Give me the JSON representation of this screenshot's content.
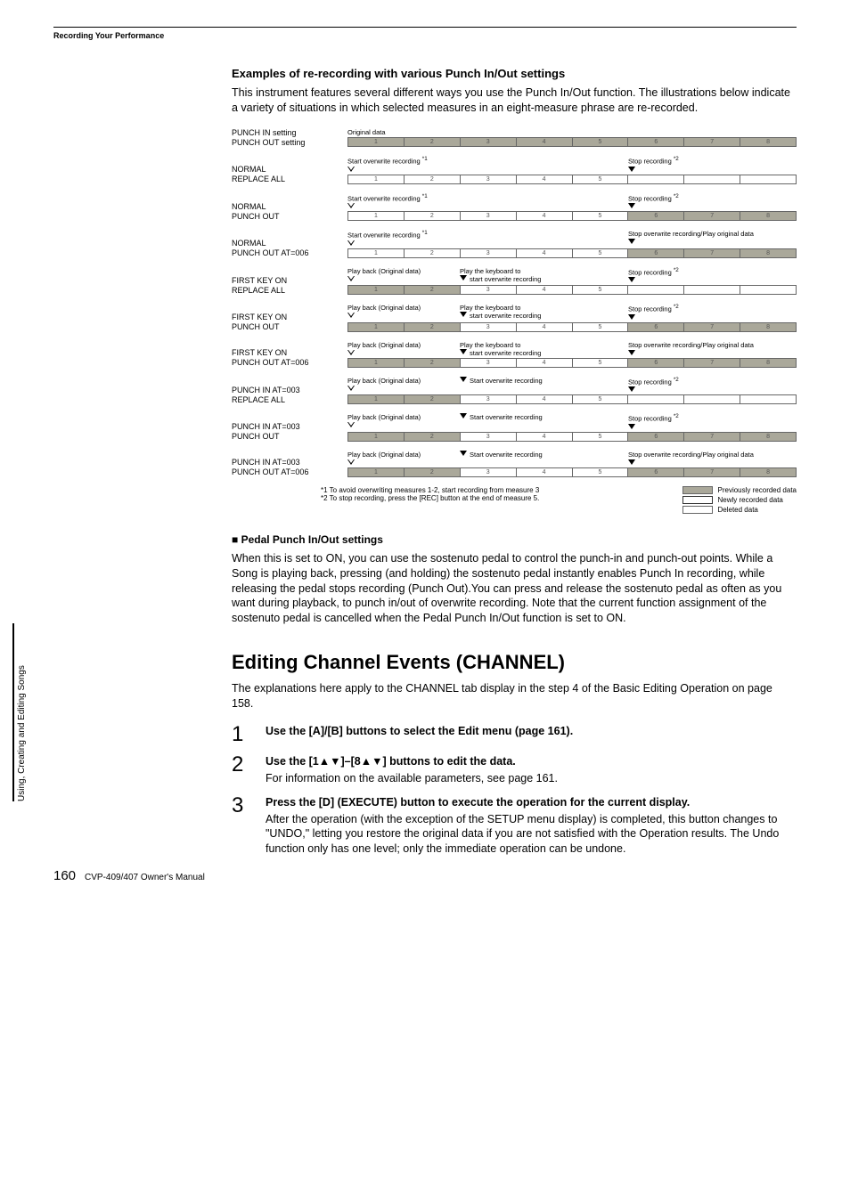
{
  "header": {
    "section": "Recording Your Performance"
  },
  "intro": {
    "title": "Examples of re-recording with various Punch In/Out settings",
    "body": "This instrument features several different ways you use the Punch In/Out function. The illustrations below indicate a variety of situations in which selected measures in an eight-measure phrase are re-recorded."
  },
  "diagram": {
    "row_label_1": "PUNCH IN setting",
    "row_label_2": "PUNCH OUT setting",
    "original": "Original data",
    "start_overwrite": "Start overwrite recording",
    "stop_rec": "Stop recording",
    "stop_over_play": "Stop overwrite recording/Play original data",
    "playback_orig": "Play back (Original data)",
    "play_kb": "Play the keyboard to",
    "start_over": "start overwrite recording",
    "start_over_line": "Start overwrite recording",
    "sup1": "*1",
    "sup2": "*2",
    "rows": [
      {
        "l1": "NORMAL",
        "l2": "REPLACE ALL"
      },
      {
        "l1": "NORMAL",
        "l2": "PUNCH OUT"
      },
      {
        "l1": "NORMAL",
        "l2": "PUNCH OUT AT=006"
      },
      {
        "l1": "FIRST KEY ON",
        "l2": "REPLACE ALL"
      },
      {
        "l1": "FIRST KEY ON",
        "l2": "PUNCH OUT"
      },
      {
        "l1": "FIRST KEY ON",
        "l2": "PUNCH OUT AT=006"
      },
      {
        "l1": "PUNCH IN AT=003",
        "l2": "REPLACE ALL"
      },
      {
        "l1": "PUNCH IN AT=003",
        "l2": "PUNCH OUT"
      },
      {
        "l1": "PUNCH IN AT=003",
        "l2": "PUNCH OUT AT=006"
      }
    ],
    "foot1": "*1 To avoid overwriting measures 1-2, start recording from measure 3",
    "foot2": "*2 To stop recording, press the [REC] button at the end of measure 5.",
    "legend_prev": "Previously recorded data",
    "legend_new": "Newly recorded data",
    "legend_del": "Deleted data"
  },
  "chart_data": {
    "type": "table",
    "measures": [
      1,
      2,
      3,
      4,
      5,
      6,
      7,
      8
    ],
    "cell_states_legend": {
      "P": "previously recorded data",
      "N": "newly recorded data",
      "D": "deleted data"
    },
    "rows": [
      {
        "punch_in": "PUNCH IN setting",
        "punch_out": "PUNCH OUT setting",
        "left_label": "Original data",
        "right_label": "",
        "cells": [
          "P",
          "P",
          "P",
          "P",
          "P",
          "P",
          "P",
          "P"
        ]
      },
      {
        "punch_in": "NORMAL",
        "punch_out": "REPLACE ALL",
        "left_label": "Start overwrite recording *1",
        "right_label": "Stop recording *2",
        "cells": [
          "N",
          "N",
          "N",
          "N",
          "N",
          "D",
          "D",
          "D"
        ]
      },
      {
        "punch_in": "NORMAL",
        "punch_out": "PUNCH OUT",
        "left_label": "Start overwrite recording *1",
        "right_label": "Stop recording *2",
        "cells": [
          "N",
          "N",
          "N",
          "N",
          "N",
          "P",
          "P",
          "P"
        ]
      },
      {
        "punch_in": "NORMAL",
        "punch_out": "PUNCH OUT AT=006",
        "left_label": "Start overwrite recording *1",
        "right_label": "Stop overwrite recording/Play original data",
        "cells": [
          "N",
          "N",
          "N",
          "N",
          "N",
          "P",
          "P",
          "P"
        ]
      },
      {
        "punch_in": "FIRST KEY ON",
        "punch_out": "REPLACE ALL",
        "left_label": "Play back (Original data)",
        "mid_label": "Play the keyboard to start overwrite recording",
        "right_label": "Stop recording *2",
        "cells": [
          "P",
          "P",
          "N",
          "N",
          "N",
          "D",
          "D",
          "D"
        ]
      },
      {
        "punch_in": "FIRST KEY ON",
        "punch_out": "PUNCH OUT",
        "left_label": "Play back (Original data)",
        "mid_label": "Play the keyboard to start overwrite recording",
        "right_label": "Stop recording *2",
        "cells": [
          "P",
          "P",
          "N",
          "N",
          "N",
          "P",
          "P",
          "P"
        ]
      },
      {
        "punch_in": "FIRST KEY ON",
        "punch_out": "PUNCH OUT AT=006",
        "left_label": "Play back (Original data)",
        "mid_label": "Play the keyboard to start overwrite recording",
        "right_label": "Stop overwrite recording/Play original data",
        "cells": [
          "P",
          "P",
          "N",
          "N",
          "N",
          "P",
          "P",
          "P"
        ]
      },
      {
        "punch_in": "PUNCH IN AT=003",
        "punch_out": "REPLACE ALL",
        "left_label": "Play back (Original data)",
        "mid_label": "Start overwrite recording",
        "right_label": "Stop recording *2",
        "cells": [
          "P",
          "P",
          "N",
          "N",
          "N",
          "D",
          "D",
          "D"
        ]
      },
      {
        "punch_in": "PUNCH IN AT=003",
        "punch_out": "PUNCH OUT",
        "left_label": "Play back (Original data)",
        "mid_label": "Start overwrite recording",
        "right_label": "Stop recording *2",
        "cells": [
          "P",
          "P",
          "N",
          "N",
          "N",
          "P",
          "P",
          "P"
        ]
      },
      {
        "punch_in": "PUNCH IN AT=003",
        "punch_out": "PUNCH OUT AT=006",
        "left_label": "Play back (Original data)",
        "mid_label": "Start overwrite recording",
        "right_label": "Stop overwrite recording/Play original data",
        "cells": [
          "P",
          "P",
          "N",
          "N",
          "N",
          "P",
          "P",
          "P"
        ]
      }
    ]
  },
  "pedal": {
    "title": "■ Pedal Punch In/Out settings",
    "body": "When this is set to ON, you can use the sostenuto pedal to control the punch-in and punch-out points. While a Song is playing back, pressing (and holding) the sostenuto pedal instantly enables Punch In recording, while releasing the pedal stops recording (Punch Out).You can press and release the sostenuto pedal as often as you want during playback, to punch in/out of overwrite recording. Note that the current function assignment of the sostenuto pedal is cancelled when the Pedal Punch In/Out function is set to ON."
  },
  "channel": {
    "title": "Editing Channel Events (CHANNEL)",
    "intro": "The explanations here apply to the CHANNEL tab display in the step 4 of the Basic Editing Operation on page 158.",
    "steps": [
      {
        "n": "1",
        "title": "Use the [A]/[B] buttons to select the Edit menu (page 161).",
        "body": ""
      },
      {
        "n": "2",
        "title": "Use the [1▲▼]–[8▲▼] buttons to edit the data.",
        "body": "For information on the available parameters, see page 161."
      },
      {
        "n": "3",
        "title": "Press the [D] (EXECUTE) button to execute the operation for the current display.",
        "body": "After the operation (with the exception of the SETUP menu display) is completed, this button changes to \"UNDO,\" letting you restore the original data if you are not satisfied with the Operation results. The Undo function only has one level; only the immediate operation can be undone."
      }
    ]
  },
  "sidebar": "Using, Creating and Editing Songs",
  "footer": {
    "page": "160",
    "manual": "CVP-409/407 Owner's Manual"
  }
}
